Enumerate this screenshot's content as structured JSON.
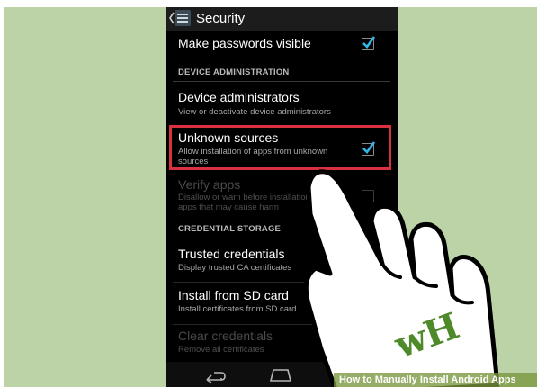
{
  "actionbar": {
    "title": "Security"
  },
  "rows": {
    "make_passwords_visible": {
      "label": "Make passwords visible",
      "checked": true
    },
    "device_administrators": {
      "label": "Device administrators",
      "summary": "View or deactivate device administrators"
    },
    "unknown_sources": {
      "label": "Unknown sources",
      "summary_line1": "Allow installation of apps from unknown",
      "summary_line2": "sources",
      "checked": true
    },
    "verify_apps": {
      "label": "Verify apps",
      "summary_line1": "Disallow or warn before installation of",
      "summary_line2": "apps that may cause harm",
      "checked": false
    },
    "trusted_credentials": {
      "label": "Trusted credentials",
      "summary": "Display trusted CA certificates"
    },
    "install_from_sd": {
      "label": "Install from SD card",
      "summary": "Install certificates from SD card"
    },
    "clear_credentials": {
      "label": "Clear credentials",
      "summary": "Remove all certificates"
    }
  },
  "sections": {
    "device_administration": "DEVICE ADMINISTRATION",
    "credential_storage": "CREDENTIAL STORAGE"
  },
  "watermark": {
    "logo_text": "wH",
    "caption": "How to Manually Install Android Apps"
  },
  "colors": {
    "background": "#bcd3a8",
    "accent": "#33b5e5",
    "highlight": "#d9323e",
    "logo": "#4f8a2a"
  },
  "icons": [
    "chevron-left-icon",
    "settings-icon",
    "checkmark-icon",
    "back-icon",
    "home-icon",
    "recents-icon",
    "hand-pointer-icon"
  ]
}
